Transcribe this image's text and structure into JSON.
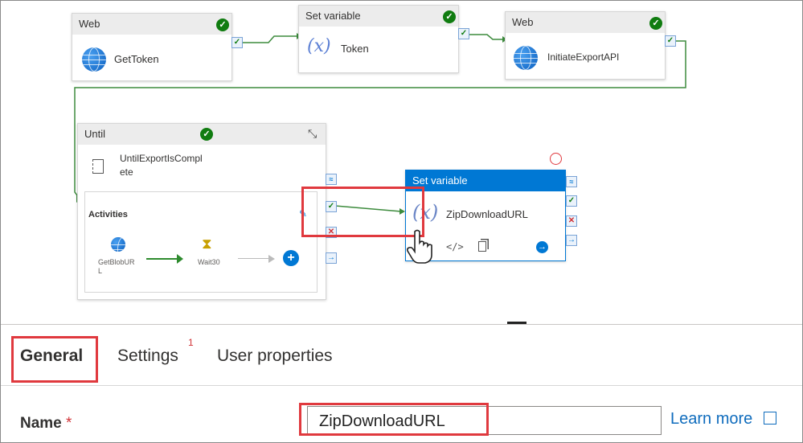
{
  "activities": {
    "gettoken": {
      "type": "Web",
      "name": "GetToken"
    },
    "token": {
      "type": "Set variable",
      "name": "Token"
    },
    "initiate": {
      "type": "Web",
      "name": "InitiateExportAPI"
    },
    "until": {
      "type": "Until",
      "name_line1": "UntilExportIsCompl",
      "name_line2": "ete",
      "activities_label": "Activities",
      "inner": [
        {
          "name": "GetBlobUR",
          "name_line2": "L"
        },
        {
          "name": "Wait30"
        }
      ]
    },
    "zip": {
      "type": "Set variable",
      "name": "ZipDownloadURL",
      "var_symbol": "(x)"
    }
  },
  "tabs": {
    "general": "General",
    "settings": "Settings",
    "settings_badge": "1",
    "user_properties": "User properties"
  },
  "form": {
    "name_label": "Name",
    "required_mark": "*",
    "name_value": "ZipDownloadURL",
    "learn_more": "Learn more"
  },
  "colors": {
    "success": "#107c10",
    "selected_header": "#0078d4",
    "highlight": "#e0393e",
    "link": "#0f6cbd"
  }
}
